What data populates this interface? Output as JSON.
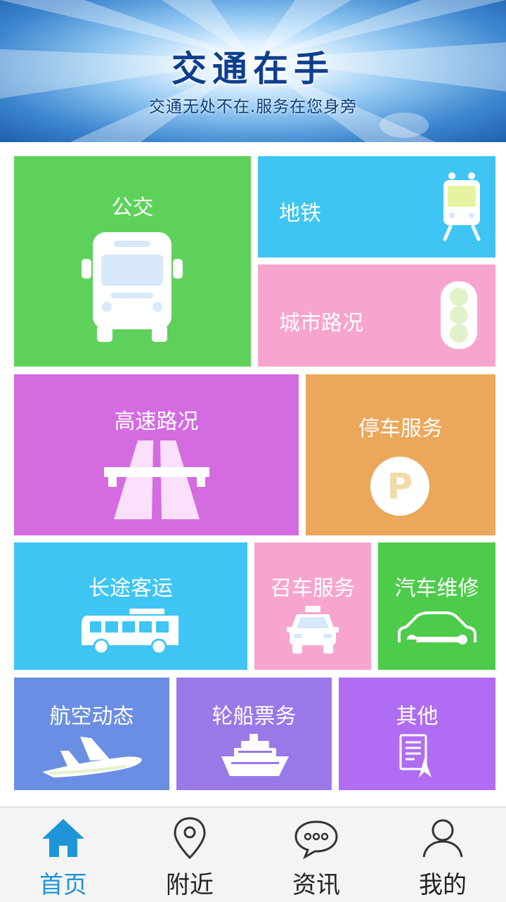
{
  "banner": {
    "title": "交通在手",
    "subtitle": "交通无处不在.服务在您身旁"
  },
  "tiles": [
    {
      "label": "公交",
      "icon": "bus-icon",
      "color": "#5ed15a"
    },
    {
      "label": "地铁",
      "icon": "subway-train-icon",
      "color": "#3ec5f3"
    },
    {
      "label": "城市路况",
      "icon": "traffic-light-icon",
      "color": "#f7a5cf"
    },
    {
      "label": "高速路况",
      "icon": "highway-icon",
      "color": "#d46be0"
    },
    {
      "label": "停车服务",
      "icon": "parking-icon",
      "color": "#eba75a"
    },
    {
      "label": "长途客运",
      "icon": "coach-bus-icon",
      "color": "#3ec5f3"
    },
    {
      "label": "召车服务",
      "icon": "taxi-icon",
      "color": "#f7a5cf"
    },
    {
      "label": "汽车维修",
      "icon": "car-repair-icon",
      "color": "#4dcb4a"
    },
    {
      "label": "航空动态",
      "icon": "airplane-icon",
      "color": "#6a8ee3"
    },
    {
      "label": "轮船票务",
      "icon": "ship-icon",
      "color": "#9a78e8"
    },
    {
      "label": "其他",
      "icon": "document-icon",
      "color": "#b06cf2"
    }
  ],
  "nav": {
    "active_color": "#1f95d8",
    "items": [
      {
        "label": "首页",
        "icon": "home-icon",
        "active": true
      },
      {
        "label": "附近",
        "icon": "location-pin-icon",
        "active": false
      },
      {
        "label": "资讯",
        "icon": "chat-bubble-icon",
        "active": false
      },
      {
        "label": "我的",
        "icon": "user-icon",
        "active": false
      }
    ]
  }
}
